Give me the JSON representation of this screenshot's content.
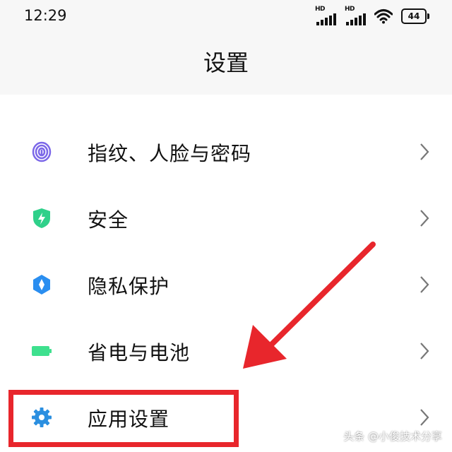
{
  "status_bar": {
    "time": "12:29",
    "sim1_label": "HD",
    "sim2_label": "HD",
    "battery_level": "44",
    "icons": [
      "signal-icon",
      "signal-icon",
      "wifi-icon",
      "battery-icon"
    ]
  },
  "header": {
    "title": "设置"
  },
  "settings_list": [
    {
      "label": "指纹、人脸与密码",
      "icon": "fingerprint-icon",
      "icon_color": "#7b67e8"
    },
    {
      "label": "安全",
      "icon": "shield-icon",
      "icon_color": "#2fd08a"
    },
    {
      "label": "隐私保护",
      "icon": "privacy-icon",
      "icon_color": "#2a8ef0"
    },
    {
      "label": "省电与电池",
      "icon": "battery-saver-icon",
      "icon_color": "#3ee08e"
    },
    {
      "label": "应用设置",
      "icon": "gear-icon",
      "icon_color": "#2b8fe0"
    }
  ],
  "annotation": {
    "color": "#e8262c",
    "highlight_target": "应用设置"
  },
  "watermark": "头条 @小俊技术分享"
}
